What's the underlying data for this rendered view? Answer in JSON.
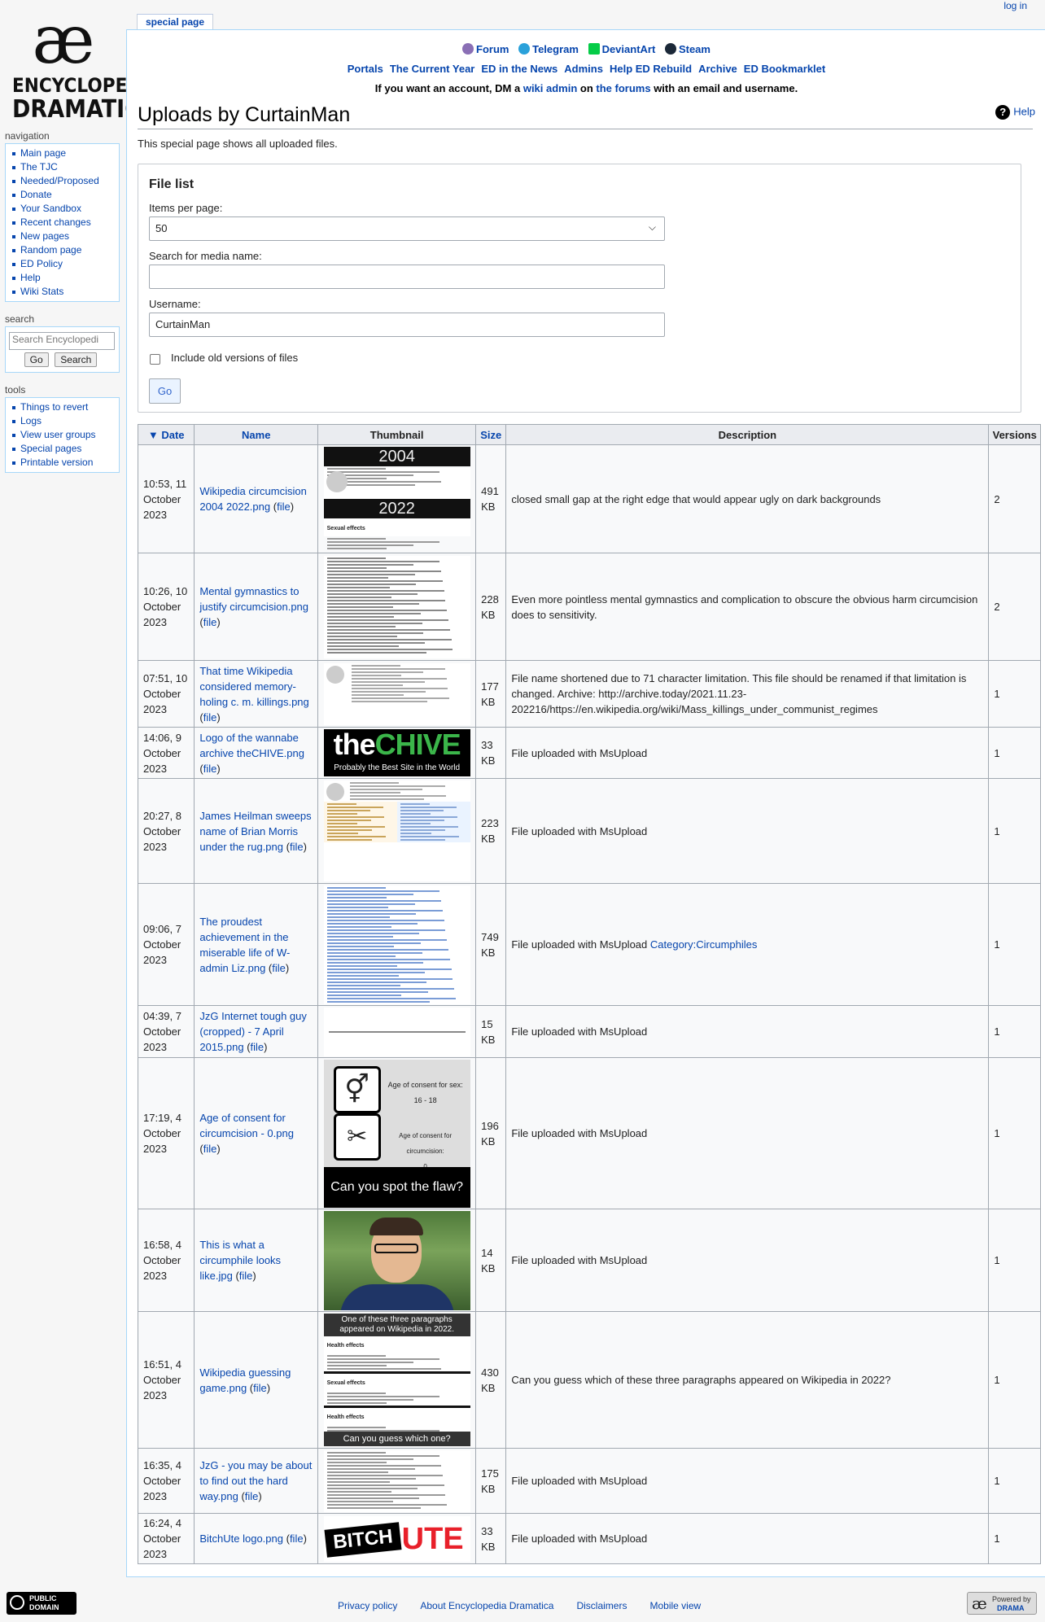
{
  "logo": {
    "ae": "æ",
    "line1": "ENCYCLOPEDIA",
    "line2": "DRAMATICA"
  },
  "personal": {
    "login": "log in"
  },
  "tabs": {
    "special": "special page"
  },
  "sitenav": {
    "row1": [
      "Forum",
      "Telegram",
      "DeviantArt",
      "Steam"
    ],
    "row2": [
      "Portals",
      "The Current Year",
      "ED in the News",
      "Admins",
      "Help ED Rebuild",
      "Archive",
      "ED Bookmarklet"
    ],
    "notice_pre": "If you want an account, DM a ",
    "notice_link1": "wiki admin",
    "notice_mid": " on ",
    "notice_link2": "the forums",
    "notice_post": " with an email and username."
  },
  "page": {
    "title": "Uploads by CurtainMan",
    "help": "Help",
    "intro": "This special page shows all uploaded files."
  },
  "form": {
    "legend": "File list",
    "per_page_label": "Items per page:",
    "per_page_value": "50",
    "search_label": "Search for media name:",
    "search_value": "",
    "username_label": "Username:",
    "username_value": "CurtainMan",
    "old_versions_label": "Include old versions of files",
    "go": "Go"
  },
  "table": {
    "headers": {
      "date": "Date",
      "date_arrow": "▼",
      "name": "Name",
      "thumbnail": "Thumbnail",
      "size": "Size",
      "description": "Description",
      "versions": "Versions"
    },
    "file_link": "file",
    "rows": [
      {
        "date": "10:53, 11 October 2023",
        "name": "Wikipedia circumcision 2004 2022.png",
        "size": "491 KB",
        "desc": "closed small gap at the right edge that would appear ugly on dark backgrounds",
        "cat": "",
        "ver": "2",
        "thumb": "wiki2004",
        "h": 133,
        "th": 128
      },
      {
        "date": "10:26, 10 October 2023",
        "name": "Mental gymnastics to justify circumcision.png",
        "size": "228 KB",
        "desc": "Even more pointless mental gymnastics and complication to obscure the obvious harm circumcision does to sensitivity.",
        "cat": "",
        "ver": "2",
        "thumb": "textdense",
        "h": 132,
        "th": 126
      },
      {
        "date": "07:51, 10 October 2023",
        "name": "That time Wikipedia considered memory-holing c. m. killings.png",
        "size": "177 KB",
        "desc": "File name shortened due to 71 character limitation. This file should be renamed if that limitation is changed. Archive: http://archive.today/2021.11.23-202216/https://en.wikipedia.org/wiki/Mass_killings_under_communist_regimes",
        "cat": "",
        "ver": "1",
        "thumb": "wikiscreen",
        "h": 82,
        "th": 76
      },
      {
        "date": "14:06, 9 October 2023",
        "name": "Logo of the wannabe archive theCHIVE.png",
        "size": "33 KB",
        "desc": "File uploaded with MsUpload",
        "cat": "",
        "ver": "1",
        "thumb": "chive",
        "h": 63,
        "th": 58,
        "thumb_line1_a": "the",
        "thumb_line1_b": "CHIVE",
        "thumb_line2": "Probably the Best Site in the World"
      },
      {
        "date": "20:27, 8 October 2023",
        "name": "James Heilman sweeps name of Brian Morris under the rug.png",
        "size": "223 KB",
        "desc": "File uploaded with MsUpload",
        "cat": "",
        "ver": "1",
        "thumb": "wikidiff",
        "h": 129,
        "th": 124
      },
      {
        "date": "09:06, 7 October 2023",
        "name": "The proudest achievement in the miserable life of W-admin Liz.png",
        "size": "749 KB",
        "desc": "File uploaded with MsUpload ",
        "cat": "Category:Circumphiles",
        "ver": "1",
        "thumb": "list",
        "h": 150,
        "th": 146
      },
      {
        "date": "04:39, 7 October 2023",
        "name": "JzG Internet tough guy (cropped) - 7 April 2015.png",
        "size": "15 KB",
        "desc": "File uploaded with MsUpload",
        "cat": "",
        "ver": "1",
        "thumb": "oneline",
        "h": 64,
        "th": 60
      },
      {
        "date": "17:19, 4 October 2023",
        "name": "Age of consent for circumcision - 0.png",
        "size": "196 KB",
        "desc": "File uploaded with MsUpload",
        "cat": "",
        "ver": "1",
        "thumb": "consent",
        "h": 186,
        "th": 182,
        "thumb_age1": "Age of consent for sex:",
        "thumb_age1b": "16 - 18",
        "thumb_age2": "Age of consent for circumcision:",
        "thumb_age2b": "0",
        "thumb_flaw": "Can you spot the flaw?"
      },
      {
        "date": "16:58, 4 October 2023",
        "name": "This is what a circumphile looks like.jpg",
        "size": "14 KB",
        "desc": "File uploaded with MsUpload",
        "cat": "",
        "ver": "1",
        "thumb": "photo",
        "h": 126,
        "th": 122
      },
      {
        "date": "16:51, 4 October 2023",
        "name": "Wikipedia guessing game.png",
        "size": "430 KB",
        "desc": "Can you guess which of these three paragraphs appeared on Wikipedia in 2022?",
        "cat": "",
        "ver": "1",
        "thumb": "guess",
        "h": 168,
        "th": 163,
        "thumb_top": "One of these three paragraphs appeared on Wikipedia in 2022.",
        "thumb_bottom": "Can you guess which one?",
        "thumb_h1": "Health effects",
        "thumb_h2": "Sexual effects",
        "thumb_h3": "Health effects"
      },
      {
        "date": "16:35, 4 October 2023",
        "name": "JzG - you may be about to find out the hard way.png",
        "size": "175 KB",
        "desc": "File uploaded with MsUpload",
        "cat": "",
        "ver": "1",
        "thumb": "textdense2",
        "h": 80,
        "th": 76
      },
      {
        "date": "16:24, 4 October 2023",
        "name": "BitchUte logo.png",
        "size": "33 KB",
        "desc": "File uploaded with MsUpload",
        "cat": "",
        "ver": "1",
        "thumb": "bitchute",
        "h": 62,
        "th": 56,
        "thumb_a": "BITCH",
        "thumb_b": "UTE"
      }
    ]
  },
  "sidebar": {
    "nav_title": "navigation",
    "nav": [
      "Main page",
      "The TJC",
      "Needed/Proposed",
      "Donate",
      "Your Sandbox",
      "Recent changes",
      "New pages",
      "Random page",
      "ED Policy",
      "Help",
      "Wiki Stats"
    ],
    "search_title": "search",
    "search_placeholder": "Search Encyclopedi",
    "go": "Go",
    "search": "Search",
    "tools_title": "tools",
    "tools": [
      "Things to revert",
      "Logs",
      "View user groups",
      "Special pages",
      "Printable version"
    ]
  },
  "footer": {
    "links": [
      "Privacy policy",
      "About Encyclopedia Dramatica",
      "Disclaimers",
      "Mobile view"
    ],
    "pd_line1": "PUBLIC",
    "pd_line2": "DOMAIN",
    "powered_line1": "Powered by",
    "powered_line2": "DRAMA"
  },
  "colors": {
    "link": "#0645ad",
    "header_bg": "#eaecf0",
    "border": "#a2a9b1",
    "chive_green": "#3bb54a",
    "bitchute_red": "#e8202a"
  }
}
